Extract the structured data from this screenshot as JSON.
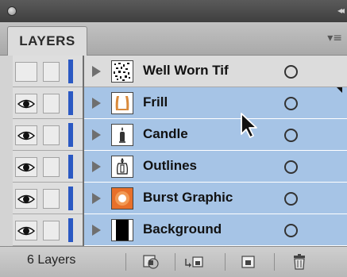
{
  "panel": {
    "tab_label": "LAYERS",
    "collapse_glyph": "◂◂",
    "menu_glyph": "▾≡"
  },
  "layers": [
    {
      "name": "Well Worn Tif",
      "visible": false,
      "selected": false,
      "thumbnail": "texture-thumbnail"
    },
    {
      "name": "Frill",
      "visible": true,
      "selected": true,
      "thumbnail": "frill-thumbnail"
    },
    {
      "name": "Candle",
      "visible": true,
      "selected": true,
      "thumbnail": "candle-thumbnail"
    },
    {
      "name": "Outlines",
      "visible": true,
      "selected": true,
      "thumbnail": "outline-thumbnail"
    },
    {
      "name": "Burst Graphic",
      "visible": true,
      "selected": true,
      "thumbnail": "burst-thumbnail"
    },
    {
      "name": "Background",
      "visible": true,
      "selected": true,
      "thumbnail": "background-thumbnail"
    }
  ],
  "footer": {
    "layer_count": "6 Layers",
    "buttons": [
      "make-clipping-mask-icon",
      "create-sublayer-icon",
      "create-new-layer-icon",
      "trash-icon"
    ]
  },
  "colors": {
    "layer_color": "#2b59c3",
    "selection": "#a6c4e6"
  }
}
